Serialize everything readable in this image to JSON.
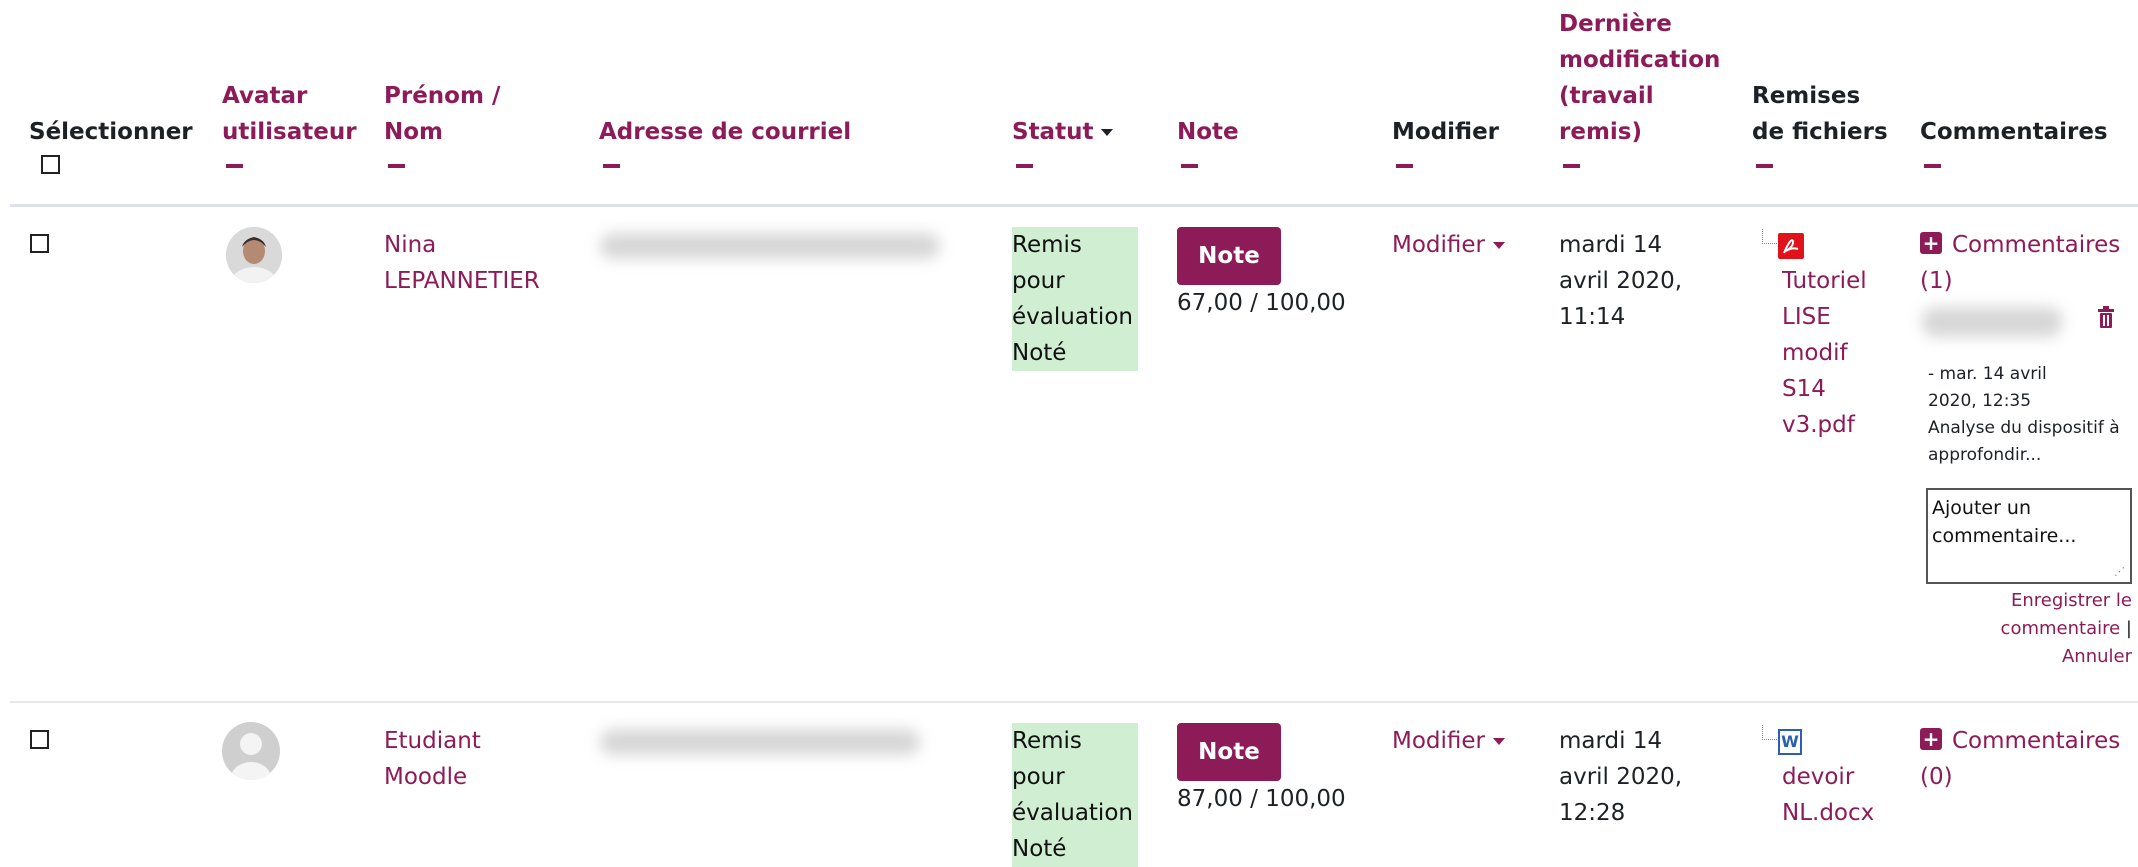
{
  "headers": {
    "select": "Sélectionner",
    "avatar_1": "Avatar",
    "avatar_2": "utilisateur",
    "name_1": "Prénom /",
    "name_2": "Nom",
    "email": "Adresse de courriel",
    "status": "Statut",
    "grade": "Note",
    "edit": "Modifier",
    "lastmod_1": "Dernière",
    "lastmod_2": "modification",
    "lastmod_3": "(travail",
    "lastmod_4": "remis)",
    "files_1": "Remises",
    "files_2": "de fichiers",
    "comments": "Commentaires"
  },
  "rows": [
    {
      "first_name": "Nina",
      "last_name": "LEPANNETIER",
      "status_lines": [
        "Remis",
        "pour",
        "évaluation",
        "Noté"
      ],
      "grade_button": "Note",
      "grade_value": "67,00 / 100,00",
      "edit_label": "Modifier",
      "date_lines": [
        "mardi 14",
        "avril 2020,",
        "11:14"
      ],
      "file_icon": "pdf-icon",
      "file_lines": [
        "Tutoriel",
        "LISE",
        "modif",
        "S14",
        "v3.pdf"
      ],
      "comments_label": "Commentaires",
      "comments_count": "(1)",
      "comment_date_1": "- mar. 14 avril",
      "comment_date_2": "2020, 12:35",
      "comment_text_1": "Analyse du dispositif à",
      "comment_text_2": "approfondir...",
      "comment_placeholder": "Ajouter un commentaire...",
      "save_1": "Enregistrer le",
      "save_2": "commentaire",
      "separator": "|",
      "cancel": "Annuler"
    },
    {
      "first_name": "Etudiant",
      "last_name": "Moodle",
      "status_lines": [
        "Remis",
        "pour",
        "évaluation",
        "Noté"
      ],
      "grade_button": "Note",
      "grade_value": "87,00 / 100,00",
      "edit_label": "Modifier",
      "date_lines": [
        "mardi 14",
        "avril 2020,",
        "12:28"
      ],
      "file_icon": "word-icon",
      "file_lines": [
        "devoir",
        "NL.docx"
      ],
      "comments_label": "Commentaires",
      "comments_count": "(0)"
    }
  ],
  "colors": {
    "accent": "#8d1b58",
    "status_bg": "#d0eed2",
    "pdf_red": "#e0121b",
    "word_blue": "#2b5fb3"
  }
}
